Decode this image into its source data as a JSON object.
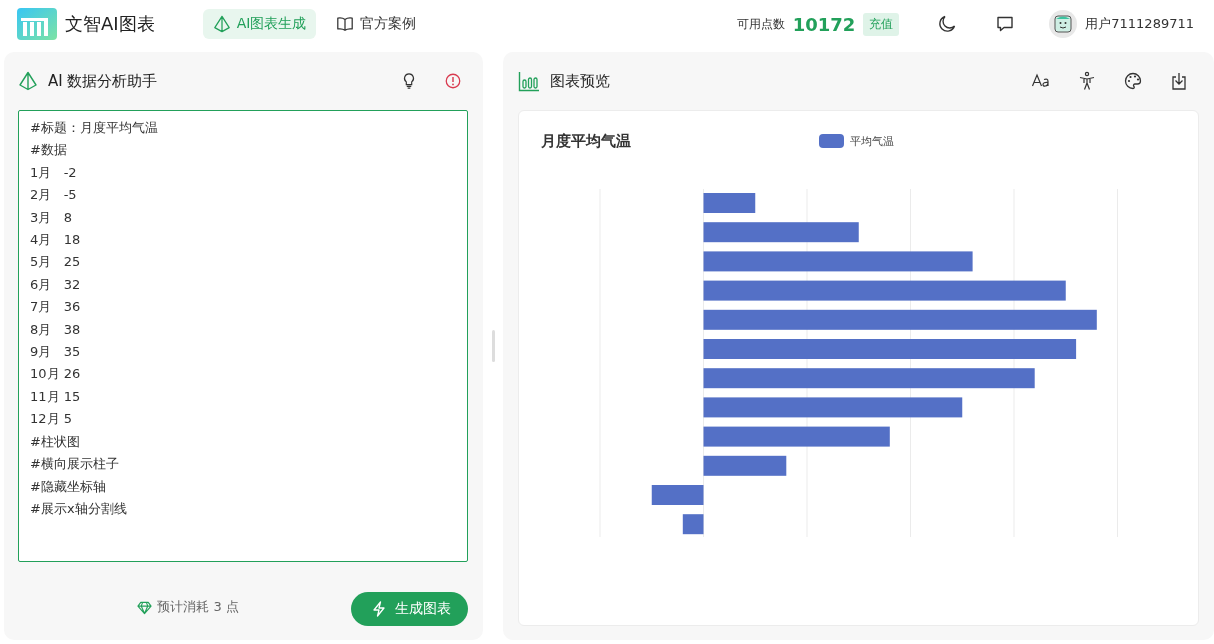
{
  "header": {
    "app_name": "文智AI图表",
    "nav": [
      {
        "label": "AI图表生成",
        "selected": true
      },
      {
        "label": "官方案例",
        "selected": false
      }
    ],
    "points_label": "可用点数",
    "points": "10172",
    "recharge": "充值",
    "user": "用户7111289711"
  },
  "assistant": {
    "title": "AI 数据分析助手",
    "input_lines": [
      "#标题：月度平均气温",
      "#数据",
      "1月   -2",
      "2月   -5",
      "3月   8",
      "4月   18",
      "5月   25",
      "6月   32",
      "7月   36",
      "8月   38",
      "9月   35",
      "10月 26",
      "11月 15",
      "12月 5",
      "#柱状图",
      "#横向展示柱子",
      "#隐藏坐标轴",
      "#展示x轴分割线"
    ],
    "cost": "预计消耗 3 点",
    "generate": "生成图表"
  },
  "preview": {
    "title": "图表预览",
    "chart": {
      "title": "月度平均气温",
      "legend": "平均气温"
    }
  }
}
